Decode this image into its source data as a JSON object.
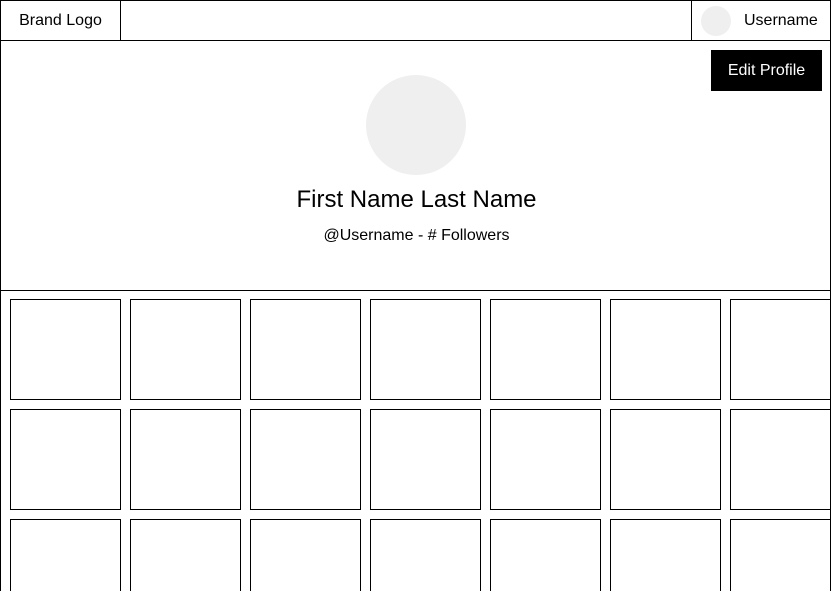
{
  "header": {
    "brand": "Brand Logo",
    "username": "Username"
  },
  "profile": {
    "edit_label": "Edit Profile",
    "full_name": "First Name Last Name",
    "meta": "@Username - # Followers"
  },
  "grid": {
    "rows": 3,
    "columns": 7
  },
  "colors": {
    "avatar_placeholder": "#efefef",
    "button_bg": "#000000",
    "button_text": "#ffffff",
    "border": "#000000"
  }
}
